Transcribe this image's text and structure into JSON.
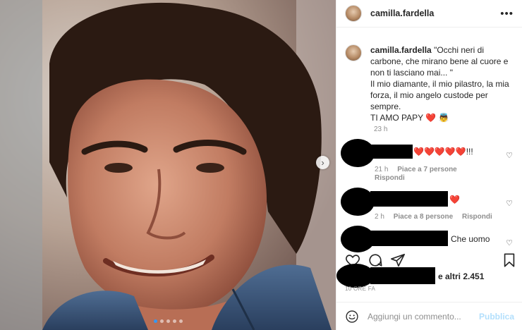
{
  "post": {
    "username": "camilla.fardella",
    "photo_label": "Photo of a smiling man with dark hair wearing a denim jacket",
    "carousel_dots": 5
  },
  "caption": {
    "username": "camilla.fardella",
    "lines": [
      "\"Occhi neri di",
      "carbone, che mirano bene al cuore e",
      "non ti lasciano mai... \"",
      "Il mio diamante, il mio pilastro, la mia",
      "forza, il mio angelo custode per",
      "sempre.",
      "TI AMO PAPY ❤️ 👼"
    ],
    "first_line": "\"Occhi neri di",
    "time": "23 h"
  },
  "comments": [
    {
      "text": "❤️❤️❤️❤️❤️!!!",
      "time": "21 h",
      "likes": "Piace a 7 persone",
      "reply": "Rispondi"
    },
    {
      "text": "❤️",
      "time": "2 h",
      "likes": "Piace a 8 persone",
      "reply": "Rispondi"
    },
    {
      "text": "Che uomo"
    }
  ],
  "likes": {
    "others": "e altri 2.451"
  },
  "posted": "10 ORE FA",
  "add_comment": {
    "placeholder": "Aggiungi un commento...",
    "publish": "Pubblica"
  },
  "icons": [
    "more-icon",
    "heart-icon",
    "comment-icon",
    "share-icon",
    "bookmark-icon",
    "emoji-icon",
    "chevron-right-icon"
  ]
}
